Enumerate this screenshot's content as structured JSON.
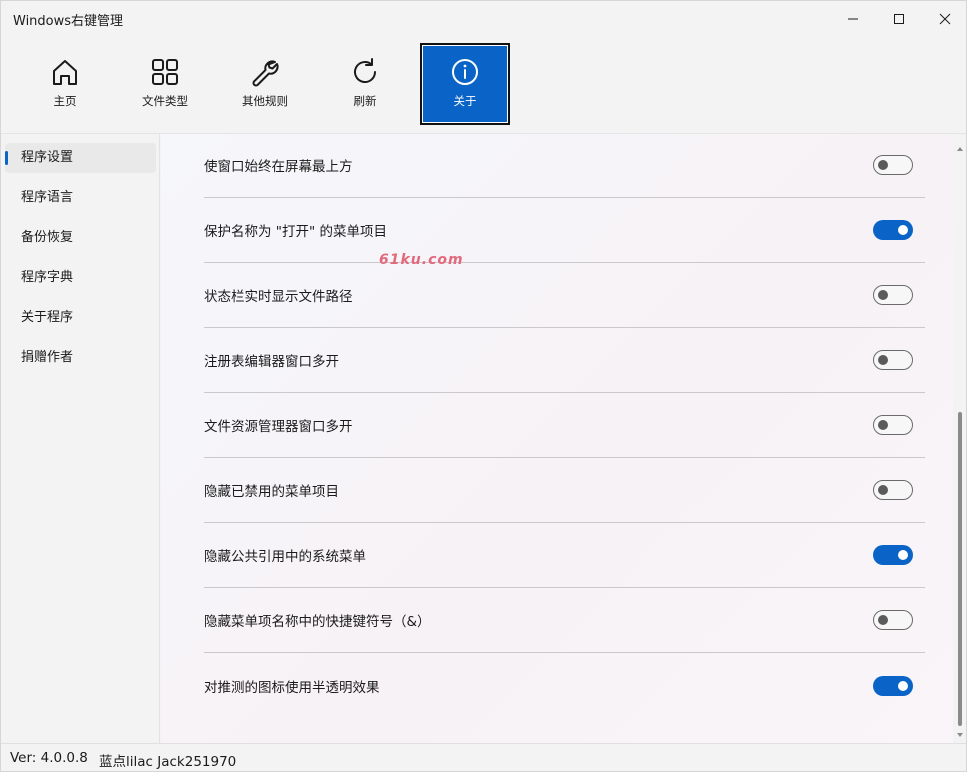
{
  "window": {
    "title": "Windows右键管理"
  },
  "titlebar": {
    "minimize_icon": "minimize-icon",
    "maximize_icon": "maximize-icon",
    "close_icon": "close-icon"
  },
  "toolbar": {
    "items": [
      {
        "label": "主页",
        "icon": "home-icon"
      },
      {
        "label": "文件类型",
        "icon": "grid-icon"
      },
      {
        "label": "其他规则",
        "icon": "wrench-icon"
      },
      {
        "label": "刷新",
        "icon": "refresh-icon"
      },
      {
        "label": "关于",
        "icon": "info-icon",
        "active": true
      }
    ],
    "accent": "#0a64c7"
  },
  "sidebar": {
    "items": [
      {
        "label": "程序设置",
        "selected": true
      },
      {
        "label": "程序语言"
      },
      {
        "label": "备份恢复"
      },
      {
        "label": "程序字典"
      },
      {
        "label": "关于程序"
      },
      {
        "label": "捐赠作者"
      }
    ]
  },
  "settings": {
    "rows": [
      {
        "label": "使窗口始终在屏幕最上方",
        "on": false
      },
      {
        "label": "保护名称为 \"打开\" 的菜单项目",
        "on": true
      },
      {
        "label": "状态栏实时显示文件路径",
        "on": false
      },
      {
        "label": "注册表编辑器窗口多开",
        "on": false
      },
      {
        "label": "文件资源管理器窗口多开",
        "on": false
      },
      {
        "label": "隐藏已禁用的菜单项目",
        "on": false
      },
      {
        "label": "隐藏公共引用中的系统菜单",
        "on": true
      },
      {
        "label": "隐藏菜单项名称中的快捷键符号（&）",
        "on": false
      },
      {
        "label": "对推测的图标使用半透明效果",
        "on": true
      }
    ],
    "watermark": "61ku.com"
  },
  "statusbar": {
    "version": "Ver: 4.0.0.8",
    "author": "蓝点lilac Jack251970"
  }
}
